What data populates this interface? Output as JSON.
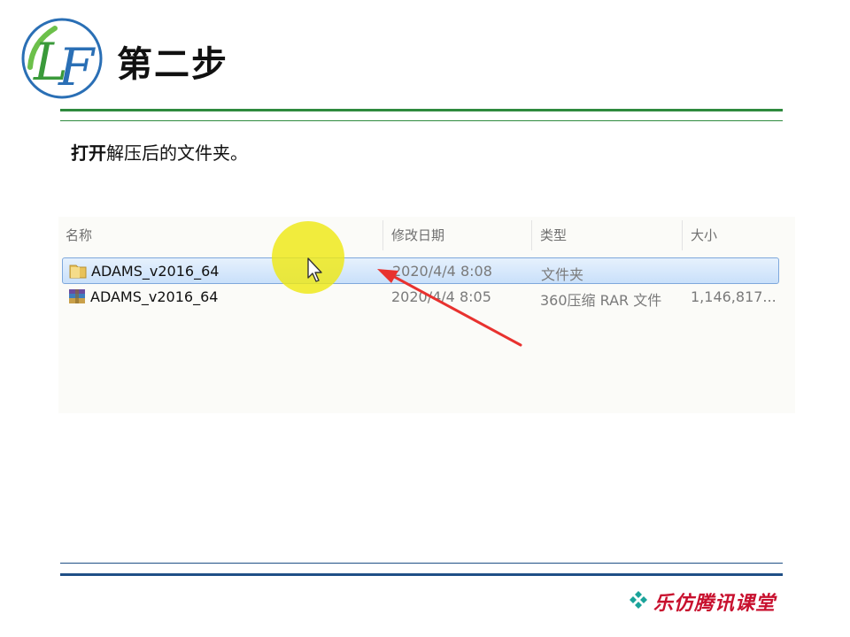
{
  "slide": {
    "title": "第二步",
    "instruction_bold": "打开",
    "instruction_rest": "解压后的文件夹。"
  },
  "explorer": {
    "columns": [
      "名称",
      "修改日期",
      "类型",
      "大小"
    ],
    "rows": [
      {
        "icon": "folder-icon",
        "name": "ADAMS_v2016_64",
        "modified": "2020/4/4 8:08",
        "type": "文件夹",
        "size": "",
        "selected": true
      },
      {
        "icon": "rar-archive-icon",
        "name": "ADAMS_v2016_64",
        "modified": "2020/4/4 8:05",
        "type": "360压缩 RAR 文件",
        "size": "1,146,817...",
        "selected": false
      }
    ]
  },
  "annotation": {
    "arrow_color": "#e8322f",
    "highlight_color": "#eee814"
  },
  "footer": {
    "brand": "乐仿腾讯课堂"
  },
  "colors": {
    "top_rule": "#2f8a3e",
    "bottom_rule": "#1f4f86",
    "brand_red": "#c8102e"
  }
}
